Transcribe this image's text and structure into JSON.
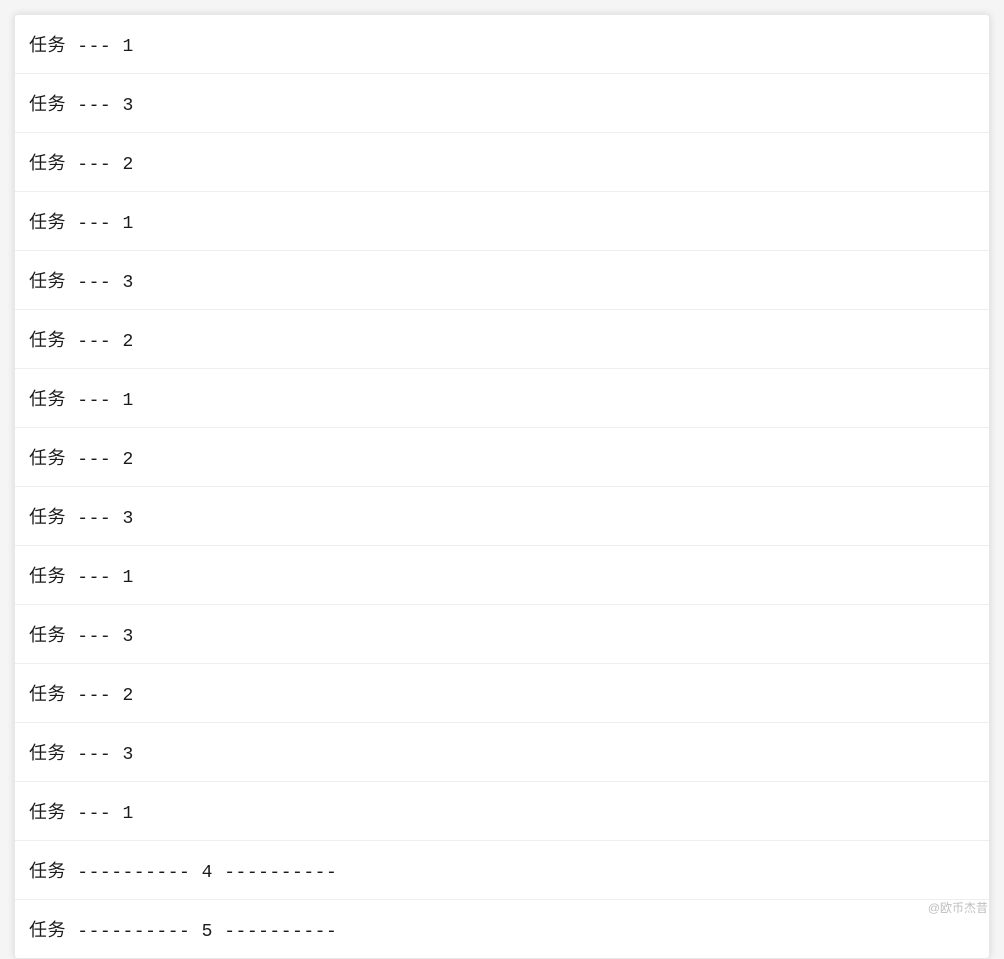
{
  "list": {
    "items": [
      "任务 --- 1",
      "任务 --- 3",
      "任务 --- 2",
      "任务 --- 1",
      "任务 --- 3",
      "任务 --- 2",
      "任务 --- 1",
      "任务 --- 2",
      "任务 --- 3",
      "任务 --- 1",
      "任务 --- 3",
      "任务 --- 2",
      "任务 --- 3",
      "任务 --- 1",
      "任务 ---------- 4 ----------",
      "任务 ---------- 5 ----------"
    ]
  },
  "watermark": "@欧币杰昔"
}
